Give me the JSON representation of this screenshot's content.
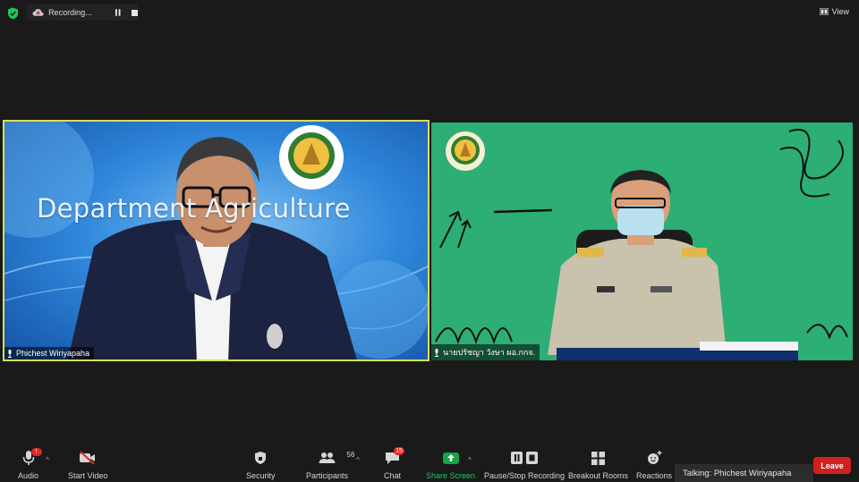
{
  "top_bar": {
    "recording_label": "Recording...",
    "view_label": "View",
    "icons": [
      "shield-check-icon",
      "cloud-icon",
      "pause-icon",
      "stop-icon",
      "grid-view-icon"
    ]
  },
  "participants_tiles": [
    {
      "name": "Phichest Wiriyapaha",
      "active_speaker": true,
      "backdrop_text": "Department  Agriculture"
    },
    {
      "name": "นายปรัชญา วังษา ผอ.กกจ.",
      "active_speaker": false
    }
  ],
  "toolbar": {
    "audio": {
      "label": "Audio",
      "badge": "!"
    },
    "start_video": {
      "label": "Start Video"
    },
    "security": {
      "label": "Security"
    },
    "participants": {
      "label": "Participants",
      "count": "56"
    },
    "chat": {
      "label": "Chat",
      "badge": "15"
    },
    "share_screen": {
      "label": "Share Screen"
    },
    "recording": {
      "label": "Pause/Stop Recording"
    },
    "breakout": {
      "label": "Breakout Rooms"
    },
    "reactions": {
      "label": "Reactions"
    },
    "leave": {
      "label": "Leave"
    }
  },
  "talking_indicator": "Talking: Phichest Wiriyapaha",
  "colors": {
    "background": "#1a1a1a",
    "active_speaker_border": "#d9e04f",
    "leave_red": "#d12020",
    "share_green": "#16a34a",
    "badge_red": "#e02828"
  }
}
